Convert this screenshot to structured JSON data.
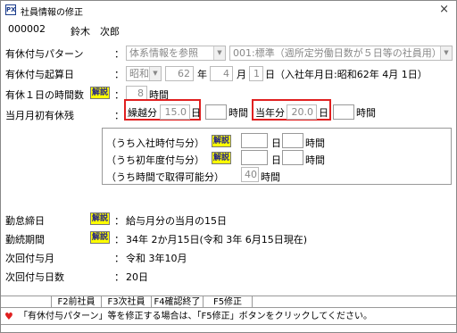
{
  "window": {
    "icon": "PX",
    "title": "社員情報の修正",
    "close": "×"
  },
  "employee": {
    "code": "000002",
    "name": "鈴木　次郎"
  },
  "rows": {
    "pattern_label": "有休付与パターン",
    "pattern_value": "体系情報を参照",
    "pattern_detail": "001:標準（週所定労働日数が５日等の社員用）",
    "start_label": "有休付与起算日",
    "start_era": "昭和",
    "start_year": "62",
    "start_year_unit": "年",
    "start_month": "4",
    "start_month_unit": "月",
    "start_day": "1",
    "start_day_unit": "日",
    "start_note": "（入社年月日:昭和62年 4月 1日）",
    "hours_label": "有休１日の時間数",
    "hours_value": "8",
    "hours_unit": "時間",
    "remain_label": "当月月初有休残",
    "carry_label": "繰越分",
    "carry_value": "15.0",
    "carry_unit": "日",
    "carry_hours_unit": "時間",
    "current_label": "当年分",
    "current_value": "20.0",
    "current_unit": "日",
    "current_hours_unit": "時間",
    "sub1_label": "（うち入社時付与分）",
    "sub1_day_unit": "日",
    "sub1_hour_unit": "時間",
    "sub2_label": "（うち初年度付与分）",
    "sub2_day_unit": "日",
    "sub2_hour_unit": "時間",
    "sub3_label": "（うち時間で取得可能分）",
    "sub3_value": "40",
    "sub3_unit": "時間",
    "closing_label": "勤怠締日",
    "closing_value": "給与月分の当月の15日",
    "tenure_label": "勤続期間",
    "tenure_value": "34年 2か月15日(令和 3年 6月15日現在)",
    "next_month_label": "次回付与月",
    "next_month_value": "令和 3年10月",
    "next_days_label": "次回付与日数",
    "next_days_value": "20日"
  },
  "common": {
    "colon": "：",
    "help": "解説"
  },
  "fkeys": [
    "F2前社員",
    "F3次社員",
    "F4確認終了",
    "F5修正"
  ],
  "status": {
    "icon": "heart-icon",
    "text": "「有休付与パターン」等を修正する場合は、「F5修正」ボタンをクリックしてください。"
  }
}
